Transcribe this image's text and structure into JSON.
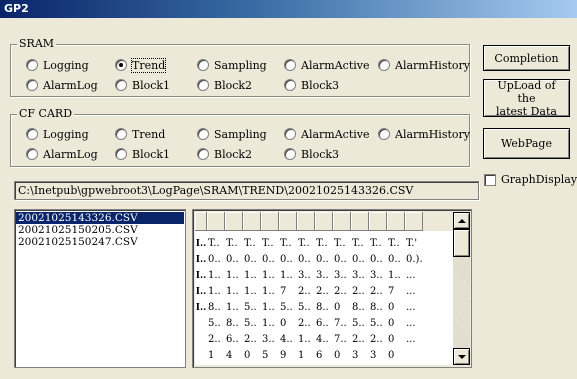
{
  "window": {
    "title": "GP2"
  },
  "sram": {
    "label": "SRAM",
    "options": [
      {
        "label": "Logging",
        "checked": false
      },
      {
        "label": "Trend",
        "checked": true
      },
      {
        "label": "Sampling",
        "checked": false
      },
      {
        "label": "AlarmActive",
        "checked": false
      },
      {
        "label": "AlarmHistory",
        "checked": false
      },
      {
        "label": "AlarmLog",
        "checked": false
      },
      {
        "label": "Block1",
        "checked": false
      },
      {
        "label": "Block2",
        "checked": false
      },
      {
        "label": "Block3",
        "checked": false
      }
    ]
  },
  "cfcard": {
    "label": "CF CARD",
    "options": [
      {
        "label": "Logging",
        "checked": false
      },
      {
        "label": "Trend",
        "checked": false
      },
      {
        "label": "Sampling",
        "checked": false
      },
      {
        "label": "AlarmActive",
        "checked": false
      },
      {
        "label": "AlarmHistory",
        "checked": false
      },
      {
        "label": "AlarmLog",
        "checked": false
      },
      {
        "label": "Block1",
        "checked": false
      },
      {
        "label": "Block2",
        "checked": false
      },
      {
        "label": "Block3",
        "checked": false
      }
    ]
  },
  "buttons": {
    "completion": "Completion",
    "upload_line1": "UpLoad of the",
    "upload_line2": "latest Data",
    "webpage": "WebPage"
  },
  "graph_display": {
    "label": "GraphDisplay",
    "checked": false
  },
  "path": "C:\\Inetpub\\gpwebroot3\\LogPage\\SRAM\\TREND\\20021025143326.CSV",
  "files": [
    {
      "name": "20021025143326.CSV",
      "selected": true
    },
    {
      "name": "20021025150205.CSV",
      "selected": false
    },
    {
      "name": "20021025150247.CSV",
      "selected": false
    }
  ],
  "grid": {
    "columns": 13,
    "rows": [
      {
        "marker": "I..",
        "cells": [
          "T..",
          "T..",
          "T..",
          "T..",
          "T..",
          "T..",
          "T..",
          "T..",
          "T..",
          "T..",
          "T..",
          "T.'"
        ]
      },
      {
        "marker": "I..",
        "cells": [
          "0..",
          "0..",
          "0..",
          "0..",
          "0..",
          "0..",
          "0..",
          "0..",
          "0..",
          "0..",
          "0..",
          "0.)."
        ]
      },
      {
        "marker": "I..",
        "cells": [
          "1..",
          "1..",
          "1..",
          "1..",
          "1..",
          "3..",
          "3..",
          "3..",
          "3..",
          "3..",
          "1..",
          "..."
        ]
      },
      {
        "marker": "I..",
        "cells": [
          "1..",
          "1..",
          "1..",
          "1..",
          "7",
          "2..",
          "2..",
          "2..",
          "2..",
          "2..",
          "7",
          "..."
        ]
      },
      {
        "marker": "I..",
        "cells": [
          "8..",
          "1..",
          "5..",
          "1..",
          "5..",
          "5..",
          "8..",
          "0",
          "8..",
          "8..",
          "0",
          "..."
        ]
      },
      {
        "marker": "",
        "cells": [
          "5..",
          "8..",
          "5..",
          "1..",
          "0",
          "2..",
          "6..",
          "7..",
          "5..",
          "5..",
          "0",
          "..."
        ]
      },
      {
        "marker": "",
        "cells": [
          "2..",
          "6..",
          "2..",
          "3..",
          "4..",
          "1..",
          "4..",
          "7..",
          "2..",
          "2..",
          "0",
          "..."
        ]
      },
      {
        "marker": "",
        "cells": [
          "1",
          "4",
          "0",
          "5",
          "9",
          "1",
          "6",
          "0",
          "3",
          "3",
          "0",
          ""
        ]
      }
    ]
  }
}
